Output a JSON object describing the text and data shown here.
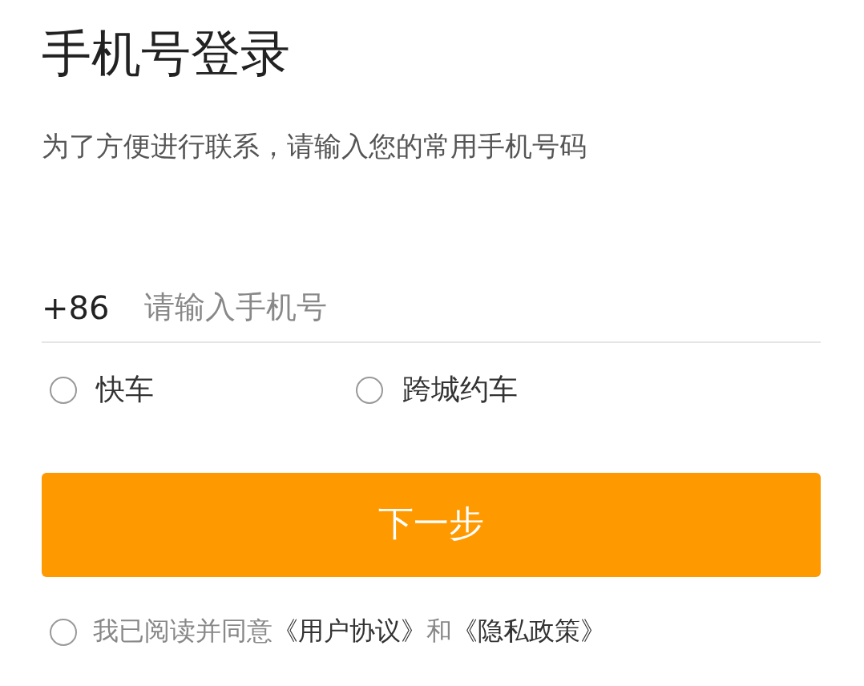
{
  "title": "手机号登录",
  "subtitle": "为了方便进行联系，请输入您的常用手机号码",
  "phone": {
    "prefix": "+86",
    "placeholder": "请输入手机号"
  },
  "options": [
    {
      "label": "快车",
      "selected": false
    },
    {
      "label": "跨城约车",
      "selected": false
    }
  ],
  "next_button": "下一步",
  "agreement": {
    "checked": false,
    "text": "我已阅读并同意",
    "links": [
      "《用户协议》",
      "《隐私政策》"
    ],
    "joiner": "和"
  }
}
